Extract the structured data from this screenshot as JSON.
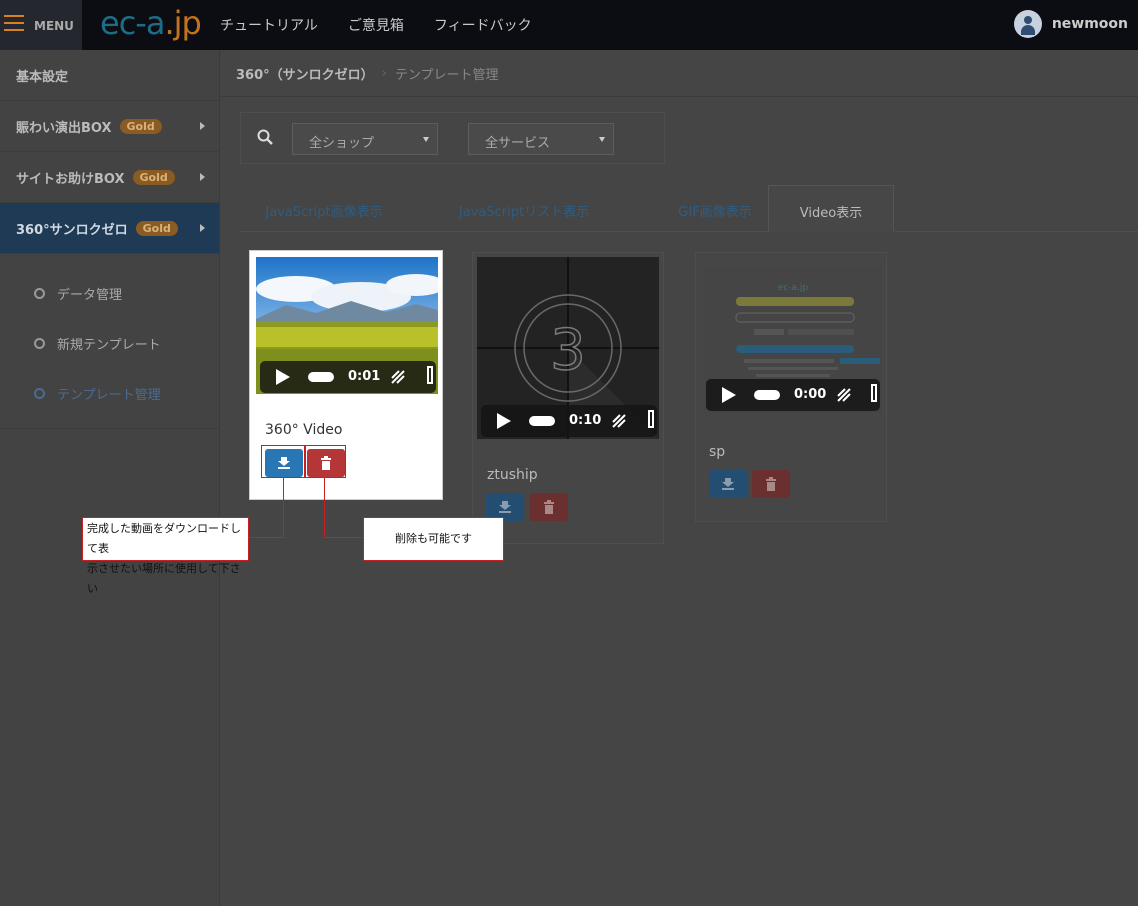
{
  "topbar": {
    "menu_label": "MENU",
    "logo_part1": "ec-a",
    "logo_part2": ".jp",
    "nav": [
      "チュートリアル",
      "ご意見箱",
      "フィードバック"
    ],
    "username": "newmoon"
  },
  "sidebar": {
    "items": [
      {
        "label": "基本設定"
      },
      {
        "label": "賑わい演出BOX",
        "badge": "Gold"
      },
      {
        "label": "サイトお助けBOX",
        "badge": "Gold"
      },
      {
        "label": "360°サンロクゼロ",
        "badge": "Gold"
      }
    ],
    "subitems": [
      "データ管理",
      "新規テンプレート",
      "テンプレート管理"
    ]
  },
  "breadcrumb": {
    "current_section": "360°（サンロクゼロ）",
    "separator": "›",
    "page": "テンプレート管理"
  },
  "filters": {
    "shop": "全ショップ",
    "service": "全サービス"
  },
  "tabs": [
    "JavaScript画像表示",
    "JavaScriptリスト表示",
    "GIF画像表示",
    "Video表示"
  ],
  "cards": [
    {
      "title": "360° Video",
      "time": "0:01"
    },
    {
      "title": "ztuship",
      "time": "0:10"
    },
    {
      "title": "sp",
      "time": "0:00"
    }
  ],
  "annotations": {
    "download_note_line1": "完成した動画をダウンロードして表",
    "download_note_line2": "示させたい場所に使用して下さい",
    "delete_note": "削除も可能です"
  },
  "colors": {
    "accent_blue": "#2877b4",
    "danger_red": "#b43636",
    "badge_gold": "#8a5c23",
    "annotation_red": "#c82020"
  }
}
